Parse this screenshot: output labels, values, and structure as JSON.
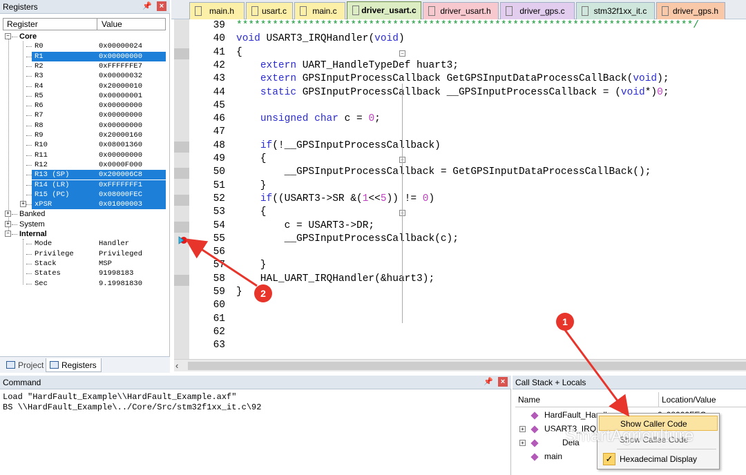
{
  "registers_panel": {
    "title": "Registers",
    "col_register": "Register",
    "col_value": "Value",
    "groups": {
      "core": "Core",
      "banked": "Banked",
      "system": "System",
      "internal": "Internal"
    },
    "core": [
      {
        "name": "R0",
        "value": "0x00000024",
        "selected": false
      },
      {
        "name": "R1",
        "value": "0x00000000",
        "selected": true
      },
      {
        "name": "R2",
        "value": "0xFFFFFFE7",
        "selected": false
      },
      {
        "name": "R3",
        "value": "0x00000032",
        "selected": false
      },
      {
        "name": "R4",
        "value": "0x20000010",
        "selected": false
      },
      {
        "name": "R5",
        "value": "0x00000001",
        "selected": false
      },
      {
        "name": "R6",
        "value": "0x00000000",
        "selected": false
      },
      {
        "name": "R7",
        "value": "0x00000000",
        "selected": false
      },
      {
        "name": "R8",
        "value": "0x00000000",
        "selected": false
      },
      {
        "name": "R9",
        "value": "0x20000160",
        "selected": false
      },
      {
        "name": "R10",
        "value": "0x08001360",
        "selected": false
      },
      {
        "name": "R11",
        "value": "0x00000000",
        "selected": false
      },
      {
        "name": "R12",
        "value": "0x0000F000",
        "selected": false
      },
      {
        "name": "R13 (SP)",
        "value": "0x200006C8",
        "selected": true
      },
      {
        "name": "R14 (LR)",
        "value": "0xFFFFFFF1",
        "selected": true
      },
      {
        "name": "R15 (PC)",
        "value": "0x08000FEC",
        "selected": true
      },
      {
        "name": "xPSR",
        "value": "0x01000003",
        "selected": true
      }
    ],
    "internal": [
      {
        "name": "Mode",
        "value": "Handler"
      },
      {
        "name": "Privilege",
        "value": "Privileged"
      },
      {
        "name": "Stack",
        "value": "MSP"
      },
      {
        "name": "States",
        "value": "91998183"
      },
      {
        "name": "Sec",
        "value": "9.19981830"
      }
    ],
    "tabs": {
      "project": "Project",
      "registers": "Registers"
    }
  },
  "editor": {
    "tabs": [
      "main.h",
      "usart.c",
      "main.c",
      "driver_usart.c",
      "driver_usart.h",
      "driver_gps.c",
      "stm32f1xx_it.c",
      "driver_gps.h"
    ],
    "active_tab": "driver_usart.c",
    "tab_colors": [
      "#fcefa8",
      "#fcefa8",
      "#fcefa8",
      "#d8ecc2",
      "#f8c8cf",
      "#e2cdef",
      "#cfe6dc",
      "#f8c8a8"
    ],
    "lines": [
      {
        "n": "39",
        "html": "<span class='cmt'>****************************************************************************/</span>"
      },
      {
        "n": "40",
        "html": "<span class='kw'>void</span> USART3_IRQHandler(<span class='kw'>void</span>)"
      },
      {
        "n": "41",
        "html": "{"
      },
      {
        "n": "42",
        "html": "    <span class='kw'>extern</span> UART_HandleTypeDef huart3;"
      },
      {
        "n": "43",
        "html": "    <span class='kw'>extern</span> GPSInputProcessCallback GetGPSInputDataProcessCallBack(<span class='kw'>void</span>);"
      },
      {
        "n": "44",
        "html": "    <span class='kw'>static</span> GPSInputProcessCallback __GPSInputProcessCallback = (<span class='kw'>void</span>*)<span class='num'>0</span>;"
      },
      {
        "n": "45",
        "html": ""
      },
      {
        "n": "46",
        "html": "    <span class='kw'>unsigned char</span> c = <span class='num'>0</span>;"
      },
      {
        "n": "47",
        "html": ""
      },
      {
        "n": "48",
        "html": "    <span class='kw'>if</span>(!__GPSInputProcessCallback)"
      },
      {
        "n": "49",
        "html": "    {"
      },
      {
        "n": "50",
        "html": "        __GPSInputProcessCallback = GetGPSInputDataProcessCallBack();"
      },
      {
        "n": "51",
        "html": "    }"
      },
      {
        "n": "52",
        "html": "    <span class='kw'>if</span>((USART3-&gt;SR &amp;(<span class='num'>1</span>&lt;&lt;<span class='num'>5</span>)) != <span class='num'>0</span>)"
      },
      {
        "n": "53",
        "html": "    {"
      },
      {
        "n": "54",
        "html": "        c = USART3-&gt;DR;"
      },
      {
        "n": "55",
        "html": "        __GPSInputProcessCallback(c);"
      },
      {
        "n": "56",
        "html": ""
      },
      {
        "n": "57",
        "html": "    }"
      },
      {
        "n": "58",
        "html": "    HAL_UART_IRQHandler(&amp;huart3);"
      },
      {
        "n": "59",
        "html": "}"
      },
      {
        "n": "60",
        "html": ""
      },
      {
        "n": "61",
        "html": ""
      },
      {
        "n": "62",
        "html": ""
      },
      {
        "n": "63",
        "html": ""
      }
    ]
  },
  "command_panel": {
    "title": "Command",
    "lines": [
      "Load \"HardFault_Example\\\\HardFault_Example.axf\"",
      "BS \\\\HardFault_Example\\../Core/Src/stm32f1xx_it.c\\92"
    ]
  },
  "callstack_panel": {
    "title": "Call Stack + Locals",
    "col_name": "Name",
    "col_location": "Location/Value",
    "rows": [
      "HardFault_Handl",
      "USART3_IRQHa",
      "Dela",
      "main"
    ],
    "row_value": "0x08000FEC"
  },
  "context_menu": {
    "show_caller": "Show Caller Code",
    "show_symbol": "Show Callee Code",
    "hex_display": "Hexadecimal Display"
  },
  "annotations": {
    "badge1": "1",
    "badge2": "2"
  },
  "watermark": "SmartAgriculture"
}
